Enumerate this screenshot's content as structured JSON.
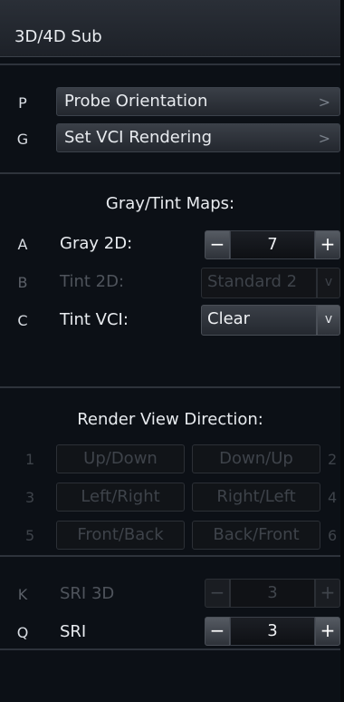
{
  "header": {
    "title": "3D/4D Sub"
  },
  "nav": [
    {
      "key": "P",
      "label": "Probe Orientation",
      "chevron": ">"
    },
    {
      "key": "G",
      "label": "Set VCI Rendering",
      "chevron": ">"
    }
  ],
  "maps": {
    "title": "Gray/Tint Maps:",
    "gray2d": {
      "key": "A",
      "label": "Gray 2D:",
      "value": "7",
      "minus": "−",
      "plus": "+"
    },
    "tint2d": {
      "key": "B",
      "label": "Tint 2D:",
      "value": "Standard 2",
      "arrow": "v"
    },
    "tintvci": {
      "key": "C",
      "label": "Tint VCI:",
      "value": "Clear",
      "arrow": "v"
    }
  },
  "render": {
    "title": "Render View Direction:",
    "rows": [
      {
        "left_num": "1",
        "left": "Up/Down",
        "right": "Down/Up",
        "right_num": "2"
      },
      {
        "left_num": "3",
        "left": "Left/Right",
        "right": "Right/Left",
        "right_num": "4"
      },
      {
        "left_num": "5",
        "left": "Front/Back",
        "right": "Back/Front",
        "right_num": "6"
      }
    ]
  },
  "sri": {
    "sri3d": {
      "key": "K",
      "label": "SRI 3D",
      "value": "3",
      "minus": "−",
      "plus": "+"
    },
    "sri": {
      "key": "Q",
      "label": "SRI",
      "value": "3",
      "minus": "−",
      "plus": "+"
    }
  },
  "colors": {
    "background": "#0c1016",
    "header": "#23272e",
    "disabled_text": "#3e434a"
  }
}
